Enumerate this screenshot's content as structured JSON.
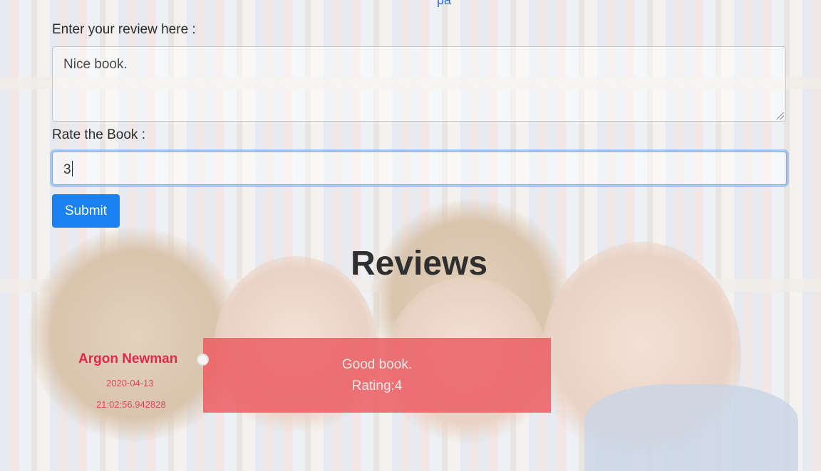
{
  "header": {
    "partial_link_text": "pa"
  },
  "form": {
    "review_label": "Enter your review here :",
    "review_value": "Nice book.",
    "rating_label": "Rate the Book :",
    "rating_value": "3",
    "submit_label": "Submit"
  },
  "reviews": {
    "title": "Reviews",
    "items": [
      {
        "name": "Argon Newman",
        "date": "2020-04-13",
        "time": "21:02:56.942828",
        "text": "Good book.",
        "rating": "Rating:4"
      }
    ]
  },
  "colors": {
    "accent": "#1a82f0",
    "reviewer_name": "#e0294e",
    "review_card": "#ec5d62"
  }
}
